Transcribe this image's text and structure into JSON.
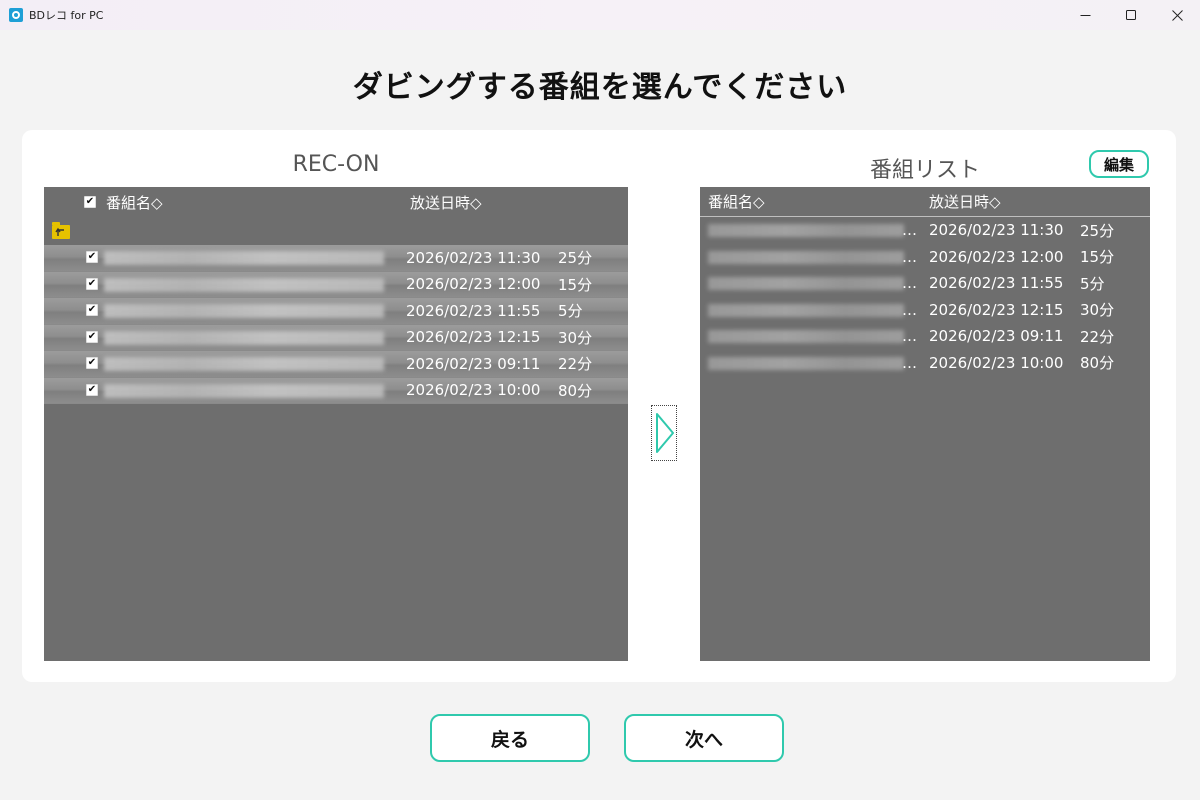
{
  "window": {
    "title": "BDレコ for PC"
  },
  "heading": "ダビングする番組を選んでください",
  "left_panel": {
    "title": "REC-ON",
    "columns": {
      "name": "番組名◇",
      "date": "放送日時◇"
    },
    "rows": [
      {
        "date": "2026/02/23 11:30",
        "duration": "25分",
        "checked": true
      },
      {
        "date": "2026/02/23 12:00",
        "duration": "15分",
        "checked": true
      },
      {
        "date": "2026/02/23 11:55",
        "duration": "5分",
        "checked": true
      },
      {
        "date": "2026/02/23 12:15",
        "duration": "30分",
        "checked": true
      },
      {
        "date": "2026/02/23 09:11",
        "duration": "22分",
        "checked": true
      },
      {
        "date": "2026/02/23 10:00",
        "duration": "80分",
        "checked": true
      }
    ]
  },
  "right_panel": {
    "title": "番組リスト",
    "edit_label": "編集",
    "columns": {
      "name": "番組名◇",
      "date": "放送日時◇"
    },
    "rows": [
      {
        "ellipsis": "…",
        "date": "2026/02/23 11:30",
        "duration": "25分"
      },
      {
        "ellipsis": "…",
        "date": "2026/02/23 12:00",
        "duration": "15分"
      },
      {
        "ellipsis": "…",
        "date": "2026/02/23 11:55",
        "duration": "5分"
      },
      {
        "ellipsis": "…",
        "date": "2026/02/23 12:15",
        "duration": "30分"
      },
      {
        "ellipsis": "…",
        "date": "2026/02/23 09:11",
        "duration": "22分"
      },
      {
        "ellipsis": "…",
        "date": "2026/02/23 10:00",
        "duration": "80分"
      }
    ]
  },
  "buttons": {
    "back": "戻る",
    "next": "次へ"
  },
  "colors": {
    "accent": "#2fc9ad",
    "panel_bg": "#6e6e6e",
    "folder": "#e6c200"
  },
  "icons": {
    "app": "app-icon",
    "minimize": "minimize-icon",
    "maximize": "maximize-icon",
    "close": "close-icon",
    "folder_up": "folder-up-icon",
    "add_arrow": "right-arrow-icon"
  }
}
